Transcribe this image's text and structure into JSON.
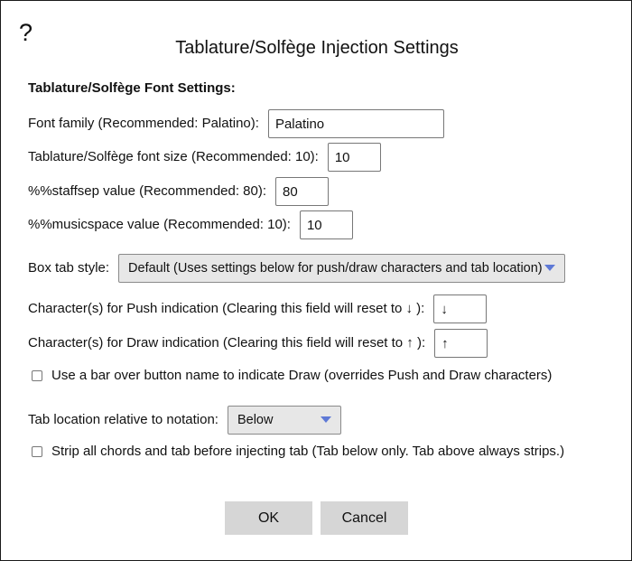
{
  "dialog": {
    "help_icon": "?",
    "title": "Tablature/Solfège Injection Settings"
  },
  "font_settings": {
    "heading": "Tablature/Solfège Font Settings:",
    "font_family": {
      "label": "Font family (Recommended: Palatino):",
      "value": "Palatino"
    },
    "font_size": {
      "label": "Tablature/Solfège font size (Recommended: 10):",
      "value": "10"
    },
    "staffsep": {
      "label": "%%staffsep value (Recommended: 80):",
      "value": "80"
    },
    "musicspace": {
      "label": "%%musicspace value (Recommended: 10):",
      "value": "10"
    }
  },
  "box_tab_style": {
    "label": "Box tab style:",
    "selected": "Default (Uses settings below for push/draw characters and tab location)"
  },
  "push": {
    "label": "Character(s) for Push indication (Clearing this field will reset to ↓ ):",
    "value": "↓"
  },
  "draw": {
    "label": "Character(s) for Draw indication (Clearing this field will reset to ↑ ):",
    "value": "↑"
  },
  "bar_over_button": {
    "label": "Use a bar over button name to indicate Draw (overrides Push and Draw characters)",
    "checked": false
  },
  "tab_location": {
    "label": "Tab location relative to notation:",
    "selected": "Below"
  },
  "strip_chords": {
    "label": "Strip all chords and tab before injecting tab (Tab below only. Tab above always strips.)",
    "checked": false
  },
  "buttons": {
    "ok": "OK",
    "cancel": "Cancel"
  },
  "colors": {
    "dropdown_arrow": "#5e79d6",
    "button_bg": "#d6d6d6",
    "select_bg": "#e7e7e7"
  }
}
